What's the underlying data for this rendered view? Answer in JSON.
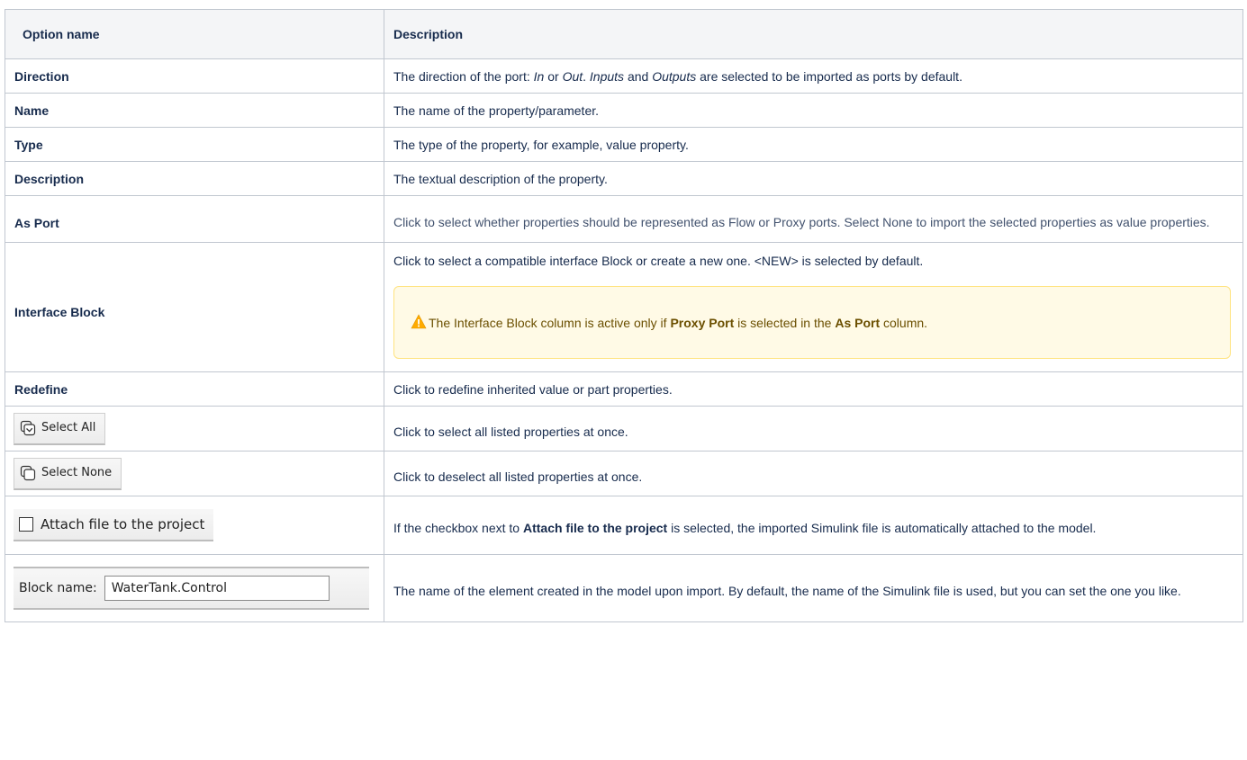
{
  "table": {
    "headers": {
      "name": "Option name",
      "description": "Description"
    },
    "direction": {
      "name": "Direction",
      "d1": "The direction of the port: ",
      "in": "In",
      "d2": " or ",
      "out": "Out",
      "d3": ". ",
      "inputs": "Inputs",
      "d4": " and ",
      "outputs": "Outputs",
      "d5": " are selected to be imported as ports by default."
    },
    "name_row": {
      "name": "Name",
      "description": "The name of the property/parameter."
    },
    "type_row": {
      "name": "Type",
      "description": "The type of the property, for example, value property."
    },
    "description_row": {
      "name": "Description",
      "description": "The textual description of the property."
    },
    "as_port": {
      "name": "As Port",
      "description": "Click to select whether properties should be represented as Flow or Proxy ports. Select None to import the selected properties as value properties."
    },
    "interface_block": {
      "name": "Interface Block",
      "description": "Click to select a compatible interface Block or create a new one. <NEW> is selected by default.",
      "note_1": "The Interface Block column is active only if ",
      "note_bold_1": "Proxy Port",
      "note_2": " is selected in the ",
      "note_bold_2": "As Port",
      "note_3": " column."
    },
    "redefine": {
      "name": "Redefine",
      "description": "Click to redefine inherited value or part properties."
    },
    "select_all": {
      "button_label": "Select All",
      "description": "Click to select all listed properties at once."
    },
    "select_none": {
      "button_label": "Select None",
      "description": "Click to deselect all listed properties at once."
    },
    "attach": {
      "checkbox_label": "Attach file to the project",
      "d1": "If the checkbox next to ",
      "bold": "Attach file to the project",
      "d2": " is selected, the imported Simulink file is automatically attached to the model."
    },
    "block_name": {
      "label": "Block name:",
      "value": "WaterTank.Control",
      "description": "The name of the element created in the model upon import. By default, the name of the Simulink file is used, but you can set the one you like."
    }
  },
  "colors": {
    "header_bg": "#f4f5f7",
    "border": "#c1c7d0",
    "note_bg": "#fffae6",
    "note_border": "#ffe380",
    "warning_icon": "#ffab00"
  }
}
